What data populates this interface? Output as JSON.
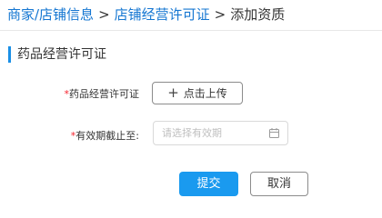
{
  "breadcrumb": {
    "items": [
      {
        "label": "商家/店铺信息"
      },
      {
        "label": "店铺经营许可证"
      }
    ],
    "separator": ">",
    "current": "添加资质"
  },
  "section": {
    "title": "药品经营许可证"
  },
  "form": {
    "license_field": {
      "required_mark": "*",
      "label": "药品经营许可证",
      "upload_icon": "plus-icon",
      "upload_label": "点击上传"
    },
    "expiry_field": {
      "required_mark": "*",
      "label": "有效期截止至:",
      "placeholder": "请选择有效期",
      "icon": "calendar-icon"
    }
  },
  "actions": {
    "submit_label": "提交",
    "cancel_label": "取消"
  },
  "colors": {
    "link": "#1677d2",
    "accent": "#1a9aef",
    "required": "#f5222d",
    "placeholder": "#bfbfbf"
  }
}
